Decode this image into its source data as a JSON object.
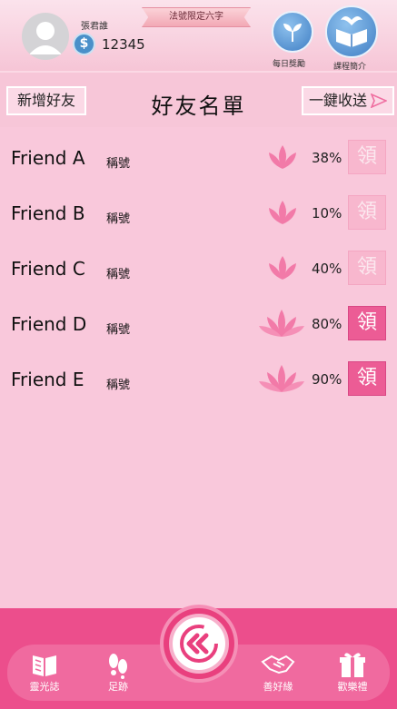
{
  "header": {
    "username": "張君誰",
    "coin_symbol": "$",
    "coin_amount": "12345",
    "ribbon": "法號限定六字",
    "daily_reward_label": "每日獎勵",
    "course_intro_label": "課程簡介"
  },
  "toolbar": {
    "add_friend_label": "新增好友",
    "title": "好友名單",
    "collect_all_label": "一鍵收送"
  },
  "friends": [
    {
      "name": "Friend A",
      "title": "稱號",
      "percent": "38%",
      "progress": 0.38,
      "claim_label": "領",
      "claimable": false,
      "lotus_size": "small"
    },
    {
      "name": "Friend B",
      "title": "稱號",
      "percent": "10%",
      "progress": 0.1,
      "claim_label": "領",
      "claimable": false,
      "lotus_size": "small"
    },
    {
      "name": "Friend C",
      "title": "稱號",
      "percent": "40%",
      "progress": 0.4,
      "claim_label": "領",
      "claimable": false,
      "lotus_size": "small"
    },
    {
      "name": "Friend D",
      "title": "稱號",
      "percent": "80%",
      "progress": 0.8,
      "claim_label": "領",
      "claimable": true,
      "lotus_size": "large"
    },
    {
      "name": "Friend E",
      "title": "稱號",
      "percent": "90%",
      "progress": 0.9,
      "claim_label": "領",
      "claimable": true,
      "lotus_size": "large"
    }
  ],
  "nav": {
    "items": [
      {
        "label": "靈光誌",
        "icon": "book-icon"
      },
      {
        "label": "足跡",
        "icon": "footprints-icon"
      },
      {
        "label": "善好緣",
        "icon": "handshake-icon"
      },
      {
        "label": "歡樂禮",
        "icon": "gift-icon"
      }
    ],
    "center_icon": "rewind-icon"
  },
  "colors": {
    "accent": "#ec4e8c",
    "claim_active": "#ec5c95",
    "claim_inactive": "#f8b7ce",
    "lotus": "#f27aa8"
  }
}
